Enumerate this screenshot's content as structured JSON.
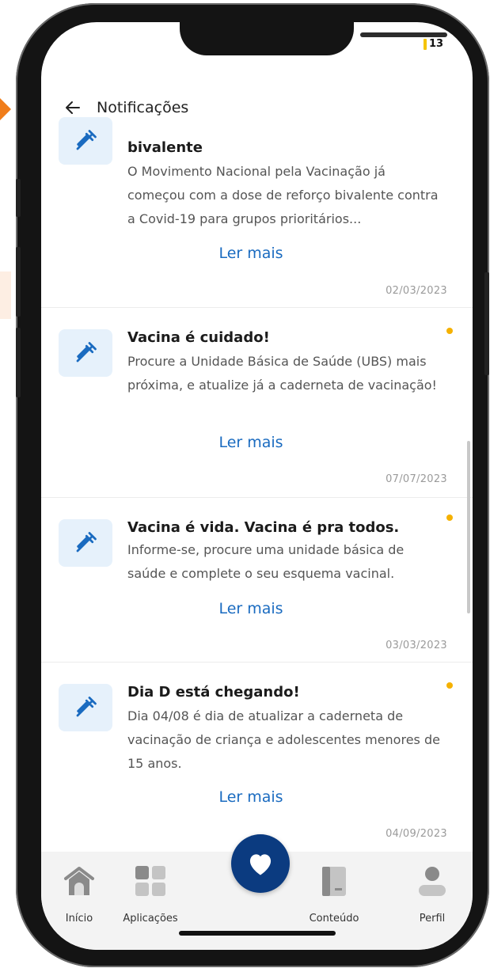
{
  "status": {
    "battery": "13"
  },
  "header": {
    "title": "Notificações"
  },
  "notifications": [
    {
      "title": "bivalente",
      "body": "O Movimento Nacional pela Vacinação já começou com a dose de reforço bivalente contra a Covid-19 para grupos prioritários...",
      "link": "Ler mais",
      "date": "02/03/2023",
      "unread": false
    },
    {
      "title": "Vacina é cuidado!",
      "body": "Procure a Unidade Básica de Saúde (UBS) mais próxima, e atualize já a caderneta de vacinação!",
      "link": "Ler mais",
      "date": "07/07/2023",
      "unread": true
    },
    {
      "title": "Vacina é vida. Vacina é pra todos.",
      "body": "Informe-se, procure uma unidade básica de saúde e complete o seu esquema vacinal.",
      "link": "Ler mais",
      "date": "03/03/2023",
      "unread": true
    },
    {
      "title": "Dia D está chegando!",
      "body": "Dia 04/08 é dia de atualizar a caderneta de vacinação de criança e adolescentes menores de 15 anos.",
      "link": "Ler mais",
      "date": "04/09/2023",
      "unread": true
    }
  ],
  "colors": {
    "accent": "#1a6bc0",
    "unread": "#f5b100",
    "fab": "#0b3b80",
    "icon_bg": "#e6f1fb"
  },
  "nav": [
    {
      "label": "Início",
      "icon": "home-icon"
    },
    {
      "label": "Aplicações",
      "icon": "grid-icon"
    },
    {
      "label": "",
      "icon": "heart-icon"
    },
    {
      "label": "Conteúdo",
      "icon": "book-icon"
    },
    {
      "label": "Perfil",
      "icon": "profile-icon"
    }
  ]
}
